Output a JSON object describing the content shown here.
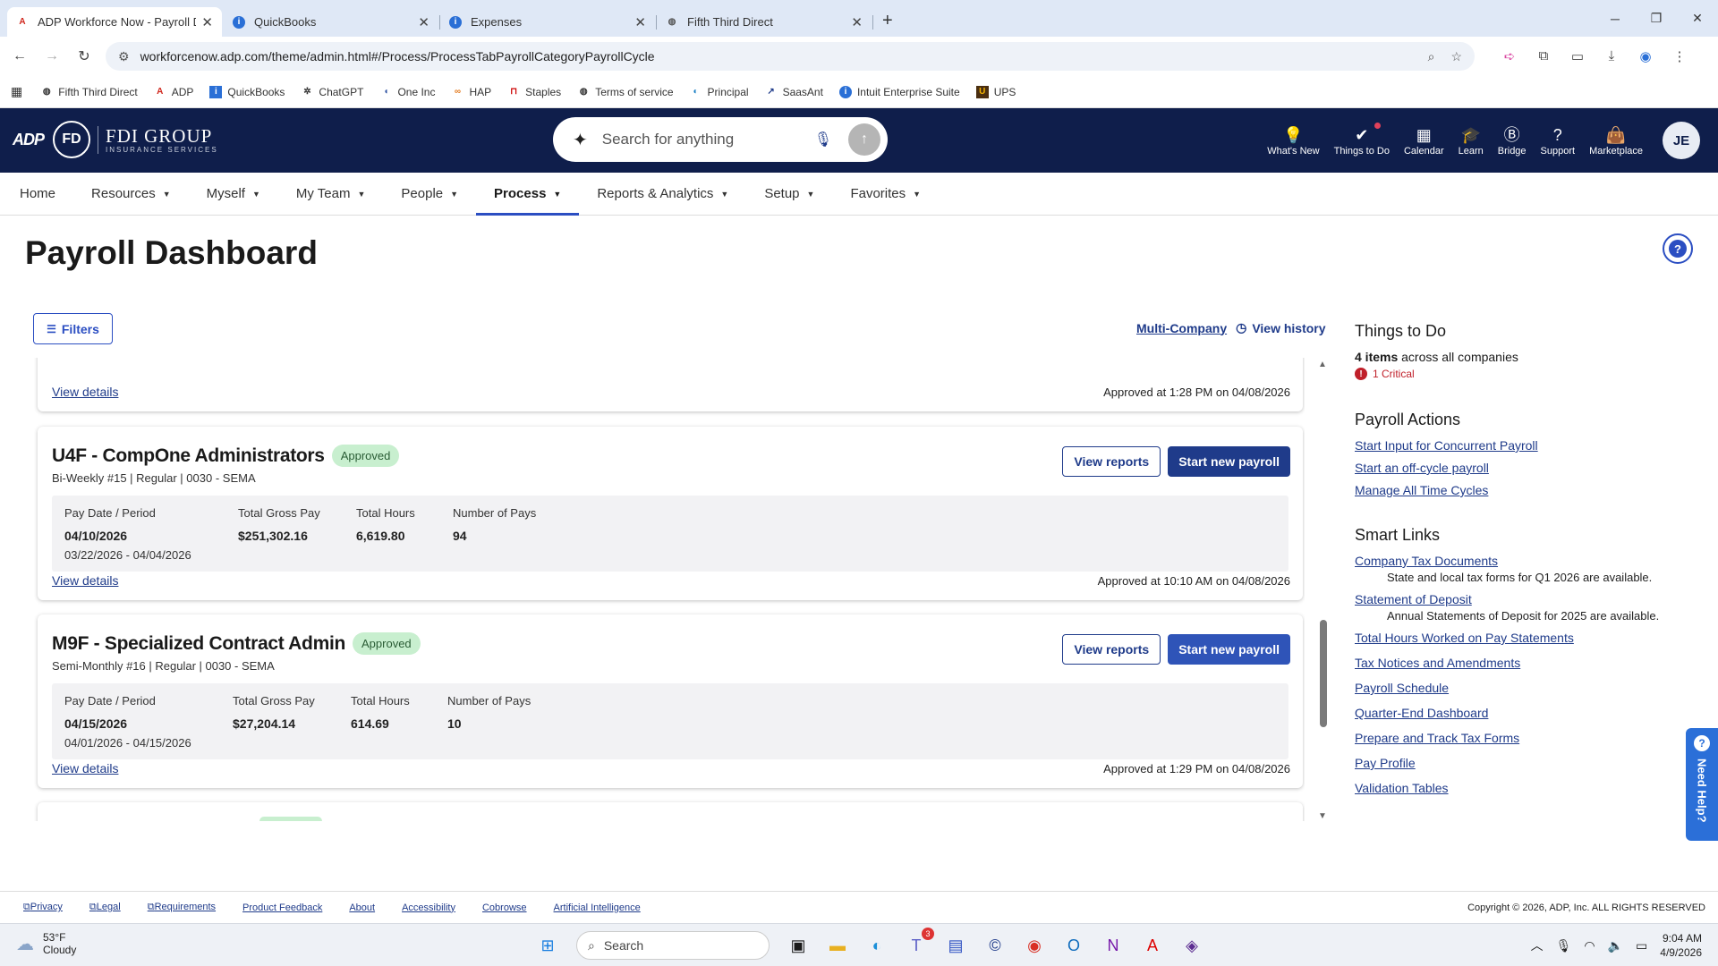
{
  "browser": {
    "tabs": [
      {
        "title": "ADP Workforce Now - Payroll D",
        "icon": "adp-icon",
        "active": true
      },
      {
        "title": "QuickBooks",
        "icon": "intuit-icon",
        "active": false
      },
      {
        "title": "Expenses",
        "icon": "intuit-icon",
        "active": false
      },
      {
        "title": "Fifth Third Direct",
        "icon": "globe-icon",
        "active": false
      }
    ],
    "new_tab": "+",
    "url": "workforcenow.adp.com/theme/admin.html#/Process/ProcessTabPayrollCategoryPayrollCycle",
    "bookmarks": [
      "Fifth Third Direct",
      "ADP",
      "QuickBooks",
      "ChatGPT",
      "One Inc",
      "HAP",
      "Staples",
      "Terms of service",
      "Principal",
      "SaasAnt",
      "Intuit Enterprise Suite",
      "UPS"
    ]
  },
  "header": {
    "logo_adp": "ADP",
    "logo_monogram": "FD",
    "logo_company": "FDI GROUP",
    "logo_tagline": "INSURANCE SERVICES",
    "search_placeholder": "Search for anything",
    "icons": [
      {
        "label": "What's New",
        "icon": "lightbulb-icon"
      },
      {
        "label": "Things to Do",
        "icon": "checkmark-circle-icon"
      },
      {
        "label": "Calendar",
        "icon": "calendar-icon"
      },
      {
        "label": "Learn",
        "icon": "graduation-cap-icon"
      },
      {
        "label": "Bridge",
        "icon": "bridge-icon"
      },
      {
        "label": "Support",
        "icon": "question-icon"
      },
      {
        "label": "Marketplace",
        "icon": "shopping-bag-icon"
      }
    ],
    "avatar": "JE"
  },
  "nav": {
    "items": [
      "Home",
      "Resources",
      "Myself",
      "My Team",
      "People",
      "Process",
      "Reports & Analytics",
      "Setup",
      "Favorites"
    ],
    "active": "Process"
  },
  "page": {
    "title": "Payroll Dashboard",
    "filters_label": "Filters",
    "multi_company": "Multi-Company",
    "view_history": "View history"
  },
  "payrolls": {
    "partial_top": {
      "view_details": "View details",
      "approved": "Approved at 1:28 PM on 04/08/2026"
    },
    "cards": [
      {
        "name": "U4F - CompOne Administrators",
        "status": "Approved",
        "subtitle": "Bi-Weekly #15 | Regular | 0030 - SEMA",
        "view_reports": "View reports",
        "start_payroll": "Start new payroll",
        "headers": [
          "Pay Date / Period",
          "Total Gross Pay",
          "Total Hours",
          "Number of Pays"
        ],
        "pay_date": "04/10/2026",
        "period": "03/22/2026 - 04/04/2026",
        "gross_pay": "$251,302.16",
        "hours": "6,619.80",
        "pays": "94",
        "view_details": "View details",
        "approved": "Approved at 10:10 AM on 04/08/2026"
      },
      {
        "name": "M9F - Specialized Contract Admin",
        "status": "Approved",
        "subtitle": "Semi-Monthly #16 | Regular | 0030 - SEMA",
        "view_reports": "View reports",
        "start_payroll": "Start new payroll",
        "headers": [
          "Pay Date / Period",
          "Total Gross Pay",
          "Total Hours",
          "Number of Pays"
        ],
        "pay_date": "04/15/2026",
        "period": "04/01/2026 - 04/15/2026",
        "gross_pay": "$27,204.14",
        "hours": "614.69",
        "pays": "10",
        "view_details": "View details",
        "approved": "Approved at 1:29 PM on 04/08/2026"
      }
    ]
  },
  "sidebar": {
    "things_title": "Things to Do",
    "items_count": "4 items",
    "items_suffix": " across all companies",
    "critical": "1 Critical",
    "actions_title": "Payroll Actions",
    "actions": [
      "Start Input for Concurrent Payroll",
      "Start an off-cycle payroll",
      "Manage All Time Cycles"
    ],
    "smart_title": "Smart Links",
    "links": [
      {
        "label": "Company Tax Documents",
        "desc": "State and local tax forms for Q1 2026 are available."
      },
      {
        "label": "Statement of Deposit",
        "desc": "Annual Statements of Deposit for 2025 are available."
      },
      {
        "label": "Total Hours Worked on Pay Statements",
        "desc": ""
      },
      {
        "label": "Tax Notices and Amendments",
        "desc": ""
      },
      {
        "label": "Payroll Schedule",
        "desc": ""
      },
      {
        "label": "Quarter-End Dashboard",
        "desc": ""
      },
      {
        "label": "Prepare and Track Tax Forms",
        "desc": ""
      },
      {
        "label": "Pay Profile",
        "desc": ""
      },
      {
        "label": "Validation Tables",
        "desc": ""
      }
    ]
  },
  "need_help": "Need Help?",
  "footer": {
    "links": [
      "Privacy",
      "Legal",
      "Requirements",
      "Product Feedback",
      "About",
      "Accessibility",
      "Cobrowse",
      "Artificial Intelligence"
    ],
    "copyright": "Copyright © 2026, ADP, Inc. ALL RIGHTS RESERVED"
  },
  "taskbar": {
    "temp": "53°F",
    "condition": "Cloudy",
    "search": "Search",
    "teams_badge": "3",
    "time": "9:04 AM",
    "date": "4/9/2026"
  }
}
